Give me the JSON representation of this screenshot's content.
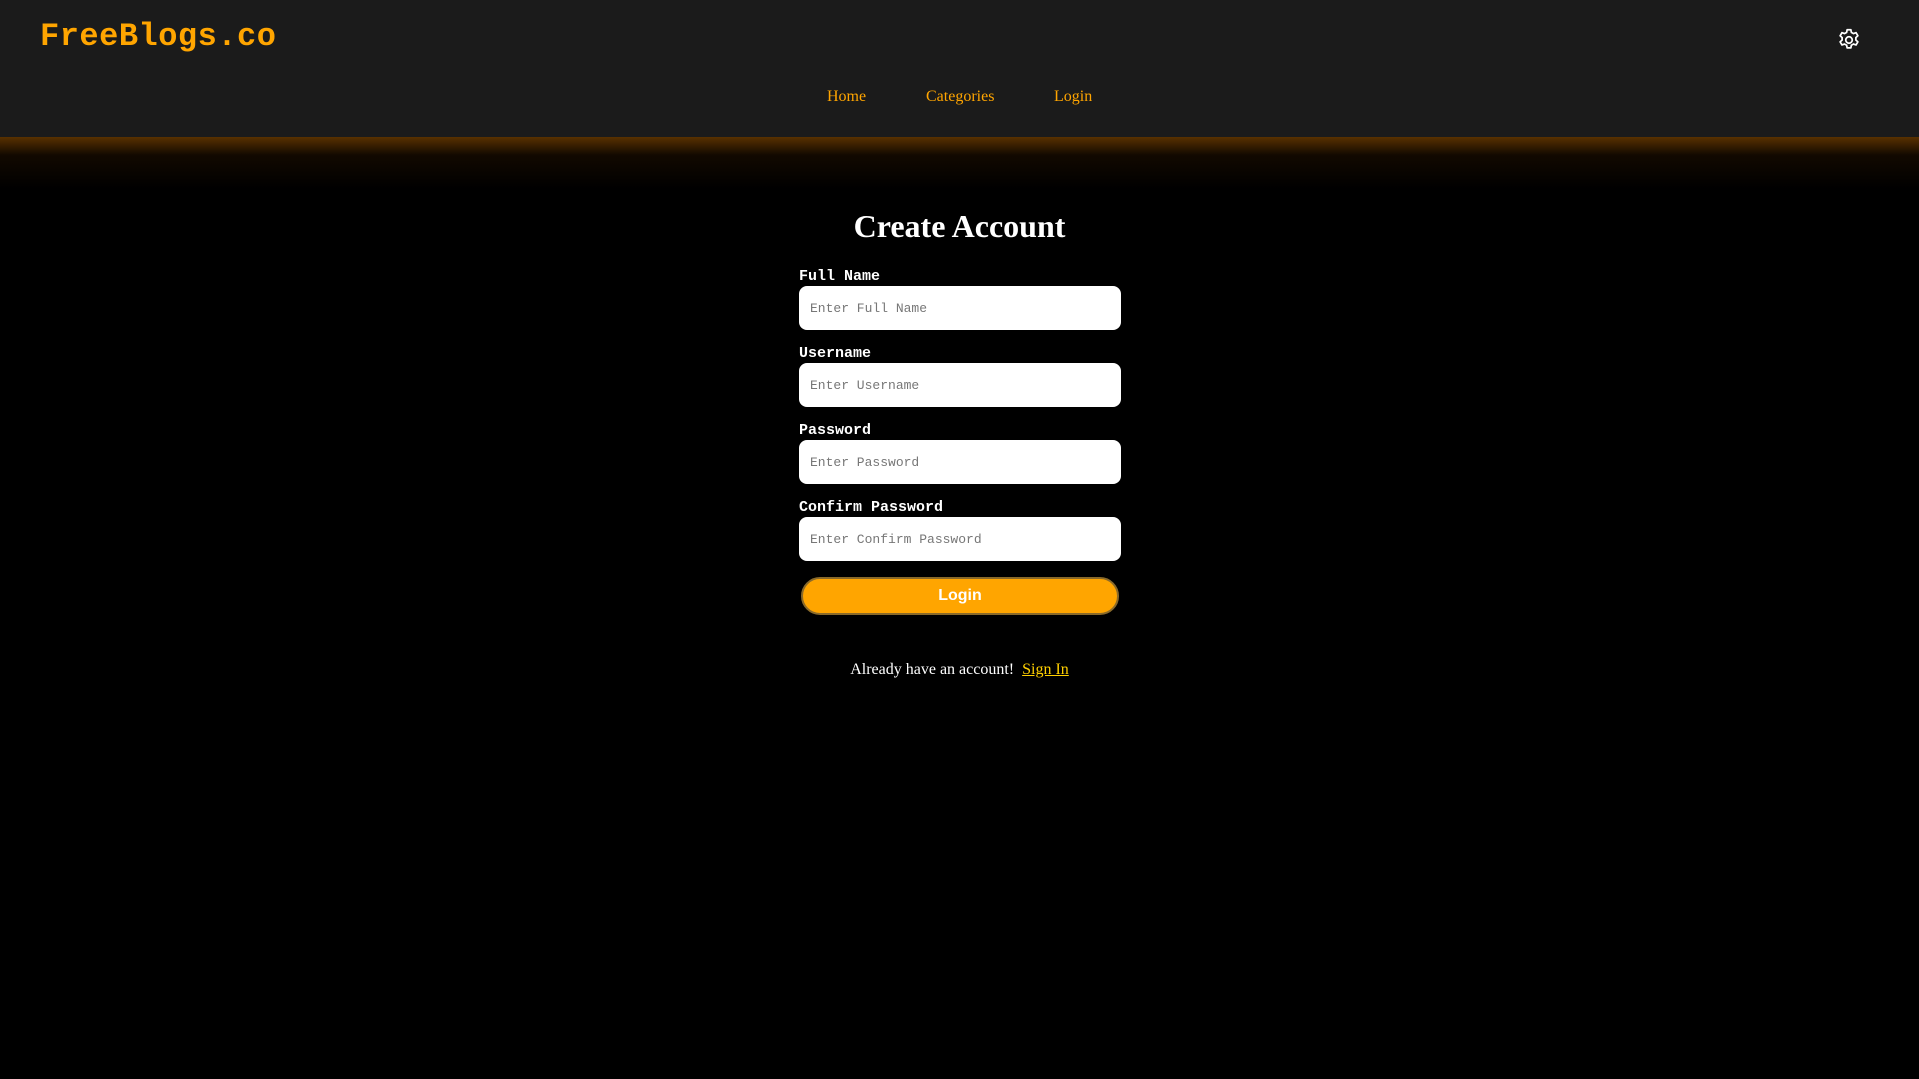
{
  "brand": {
    "name": "FreeBlogs.co"
  },
  "header": {
    "settings_icon": "gear-icon",
    "nav": {
      "home": "Home",
      "categories": "Categories",
      "login": "Login"
    }
  },
  "form": {
    "title": "Create Account",
    "fields": [
      {
        "label": "Full Name",
        "placeholder": "Enter Full Name",
        "value": ""
      },
      {
        "label": "Username",
        "placeholder": "Enter Username",
        "value": ""
      },
      {
        "label": "Password",
        "placeholder": "Enter Password",
        "value": ""
      },
      {
        "label": "Confirm Password",
        "placeholder": "Enter Confirm Password",
        "value": ""
      }
    ],
    "submit_label": "Login",
    "footer_text": "Already have an account!",
    "footer_link": "Sign In"
  },
  "colors": {
    "accent": "#ffa500",
    "header_bg": "#1b1b1b",
    "page_bg": "#000000",
    "link": "#ffd000"
  }
}
